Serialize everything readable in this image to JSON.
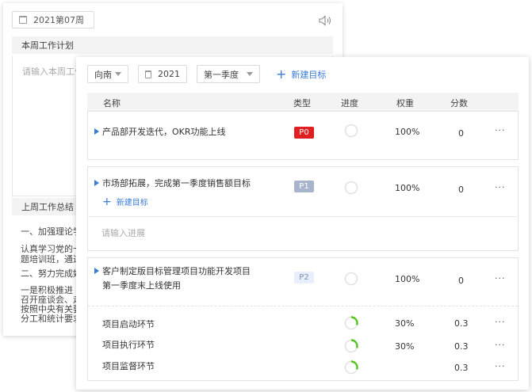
{
  "back": {
    "week": "2021第07周",
    "plan_title": "本周工作计划",
    "plan_placeholder": "请输入本周工作",
    "summary_title": "上周工作总结",
    "summary_lines": [
      "一、加强理论学",
      "认真学习党的十",
      "题培训班，通过",
      "二、努力完成好",
      "一是积极推进",
      "召开座谈会、走",
      "按照中央有关要",
      "分工和统计要求"
    ]
  },
  "filters": {
    "direction": "向南",
    "year": "2021",
    "quarter": "第一季度",
    "new_goal": "新建目标"
  },
  "table": {
    "headers": {
      "name": "名称",
      "type": "类型",
      "progress": "进度",
      "weight": "权重",
      "score": "分数"
    }
  },
  "goals": [
    {
      "name": "产品部开发迭代，OKR功能上线",
      "badge": "P0",
      "badge_bg": "#e02020",
      "badge_fg": "#ffffff",
      "progress": 0,
      "weight": "100%",
      "score": "0",
      "more": "···"
    },
    {
      "name": "市场部拓展，完成第一季度销售额目标",
      "badge": "P1",
      "badge_bg": "#a8b4cc",
      "badge_fg": "#ffffff",
      "progress": 0,
      "weight": "100%",
      "score": "0",
      "more": "···",
      "sub_new": "新建目标",
      "input_placeholder": "请输入进展"
    },
    {
      "name_line1": "客户制定版目标管理项目功能开发项目",
      "name_line2": "第一季度末上线使用",
      "badge": "P2",
      "badge_bg": "#e8eefb",
      "badge_fg": "#7a8fb8",
      "progress": 0,
      "weight": "100%",
      "score": "0",
      "more": "···",
      "subs": [
        {
          "name": "项目启动环节",
          "progress": 0.3,
          "weight": "30%",
          "score": "0.3",
          "more": "···"
        },
        {
          "name": "项目执行环节",
          "progress": 0.3,
          "weight": "30%",
          "score": "0.3",
          "more": "···"
        },
        {
          "name": "项目监督环节",
          "progress": 0.3,
          "weight": "",
          "score": "0.3",
          "more": "···"
        }
      ]
    }
  ],
  "colors": {
    "accent": "#3a7bd5",
    "progress_green": "#52c41a"
  },
  "icons": {
    "calendar": "calendar-icon",
    "speaker": "speaker-icon",
    "plus": "plus-icon",
    "flag": "flag-icon"
  }
}
